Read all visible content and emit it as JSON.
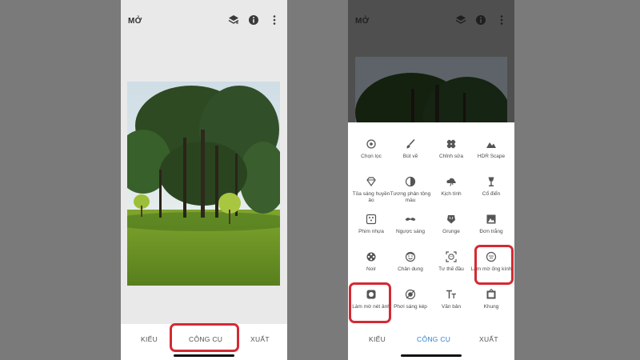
{
  "app_title": "MỞ",
  "left": {
    "nav": {
      "styles": "KIỂU",
      "tools": "CÔNG CỤ",
      "export": "XUẤT"
    }
  },
  "right": {
    "nav": {
      "styles": "KIỂU",
      "tools": "CÔNG CỤ",
      "export": "XUẤT"
    },
    "tools": [
      {
        "label": "Chọn lọc",
        "icon": "selective-icon"
      },
      {
        "label": "Bút vẽ",
        "icon": "brush-icon"
      },
      {
        "label": "Chỉnh sửa",
        "icon": "healing-icon"
      },
      {
        "label": "HDR Scape",
        "icon": "mountains-icon"
      },
      {
        "label": "Tỏa sáng huyền ảo",
        "icon": "glamour-glow-icon"
      },
      {
        "label": "Tương phản tông màu",
        "icon": "tonal-contrast-icon"
      },
      {
        "label": "Kịch tính",
        "icon": "drama-cloud-icon"
      },
      {
        "label": "Cổ điển",
        "icon": "vintage-lamp-icon"
      },
      {
        "label": "Phim nhựa",
        "icon": "grainy-film-icon"
      },
      {
        "label": "Ngược sáng",
        "icon": "mustache-icon"
      },
      {
        "label": "Grunge",
        "icon": "grunge-icon"
      },
      {
        "label": "Đơn trắng",
        "icon": "black-white-icon"
      },
      {
        "label": "Noir",
        "icon": "film-reel-icon"
      },
      {
        "label": "Chân dung",
        "icon": "face-icon"
      },
      {
        "label": "Tư thế đầu",
        "icon": "head-pose-icon"
      },
      {
        "label": "Làm mờ ống kính",
        "icon": "lens-blur-icon"
      },
      {
        "label": "Làm mờ nét ảnh",
        "icon": "vignette-icon"
      },
      {
        "label": "Phơi sáng kép",
        "icon": "double-exposure-icon"
      },
      {
        "label": "Văn bản",
        "icon": "text-icon"
      },
      {
        "label": "Khung",
        "icon": "frame-icon"
      }
    ]
  },
  "colors": {
    "highlight": "#d42a33",
    "active_tab": "#2f7fd1"
  }
}
